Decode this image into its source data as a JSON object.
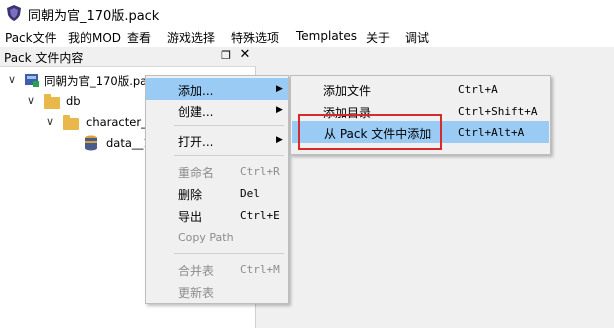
{
  "window": {
    "title": "同朝为官_170版.pack",
    "app_icon": "shield-logo-icon"
  },
  "menubar": {
    "items": [
      "Pack文件",
      "我的MOD",
      "查看",
      "游戏选择",
      "特殊选项",
      "Templates",
      "关于",
      "调试"
    ]
  },
  "dock": {
    "title": "Pack 文件内容",
    "float_icon": "restore-icon",
    "close_icon": "close-icon"
  },
  "tree": {
    "root": {
      "label": "同朝为官_170版.pa",
      "icon": "pack-file-icon"
    },
    "db": {
      "label": "db",
      "icon": "folder-icon"
    },
    "character": {
      "label": "character_",
      "icon": "folder-icon"
    },
    "data": {
      "label": "data__1",
      "icon": "database-icon"
    }
  },
  "context_menu": {
    "add": "添加...",
    "create": "创建...",
    "open": "打开...",
    "rename": {
      "label": "重命名",
      "shortcut": "Ctrl+R"
    },
    "delete": {
      "label": "删除",
      "shortcut": "Del"
    },
    "export": {
      "label": "导出",
      "shortcut": "Ctrl+E"
    },
    "copy_path": "Copy Path",
    "merge": {
      "label": "合并表",
      "shortcut": "Ctrl+M"
    },
    "update": "更新表"
  },
  "submenu": {
    "add_file": {
      "label": "添加文件",
      "shortcut": "Ctrl+A"
    },
    "add_folder": {
      "label": "添加目录",
      "shortcut": "Ctrl+Shift+A"
    },
    "add_from_pack": {
      "label": "从 Pack 文件中添加",
      "shortcut": "Ctrl+Alt+A"
    }
  },
  "colors": {
    "highlight": "#99cbf5",
    "annotation": "#d62b2b",
    "folder": "#e8b84a"
  }
}
